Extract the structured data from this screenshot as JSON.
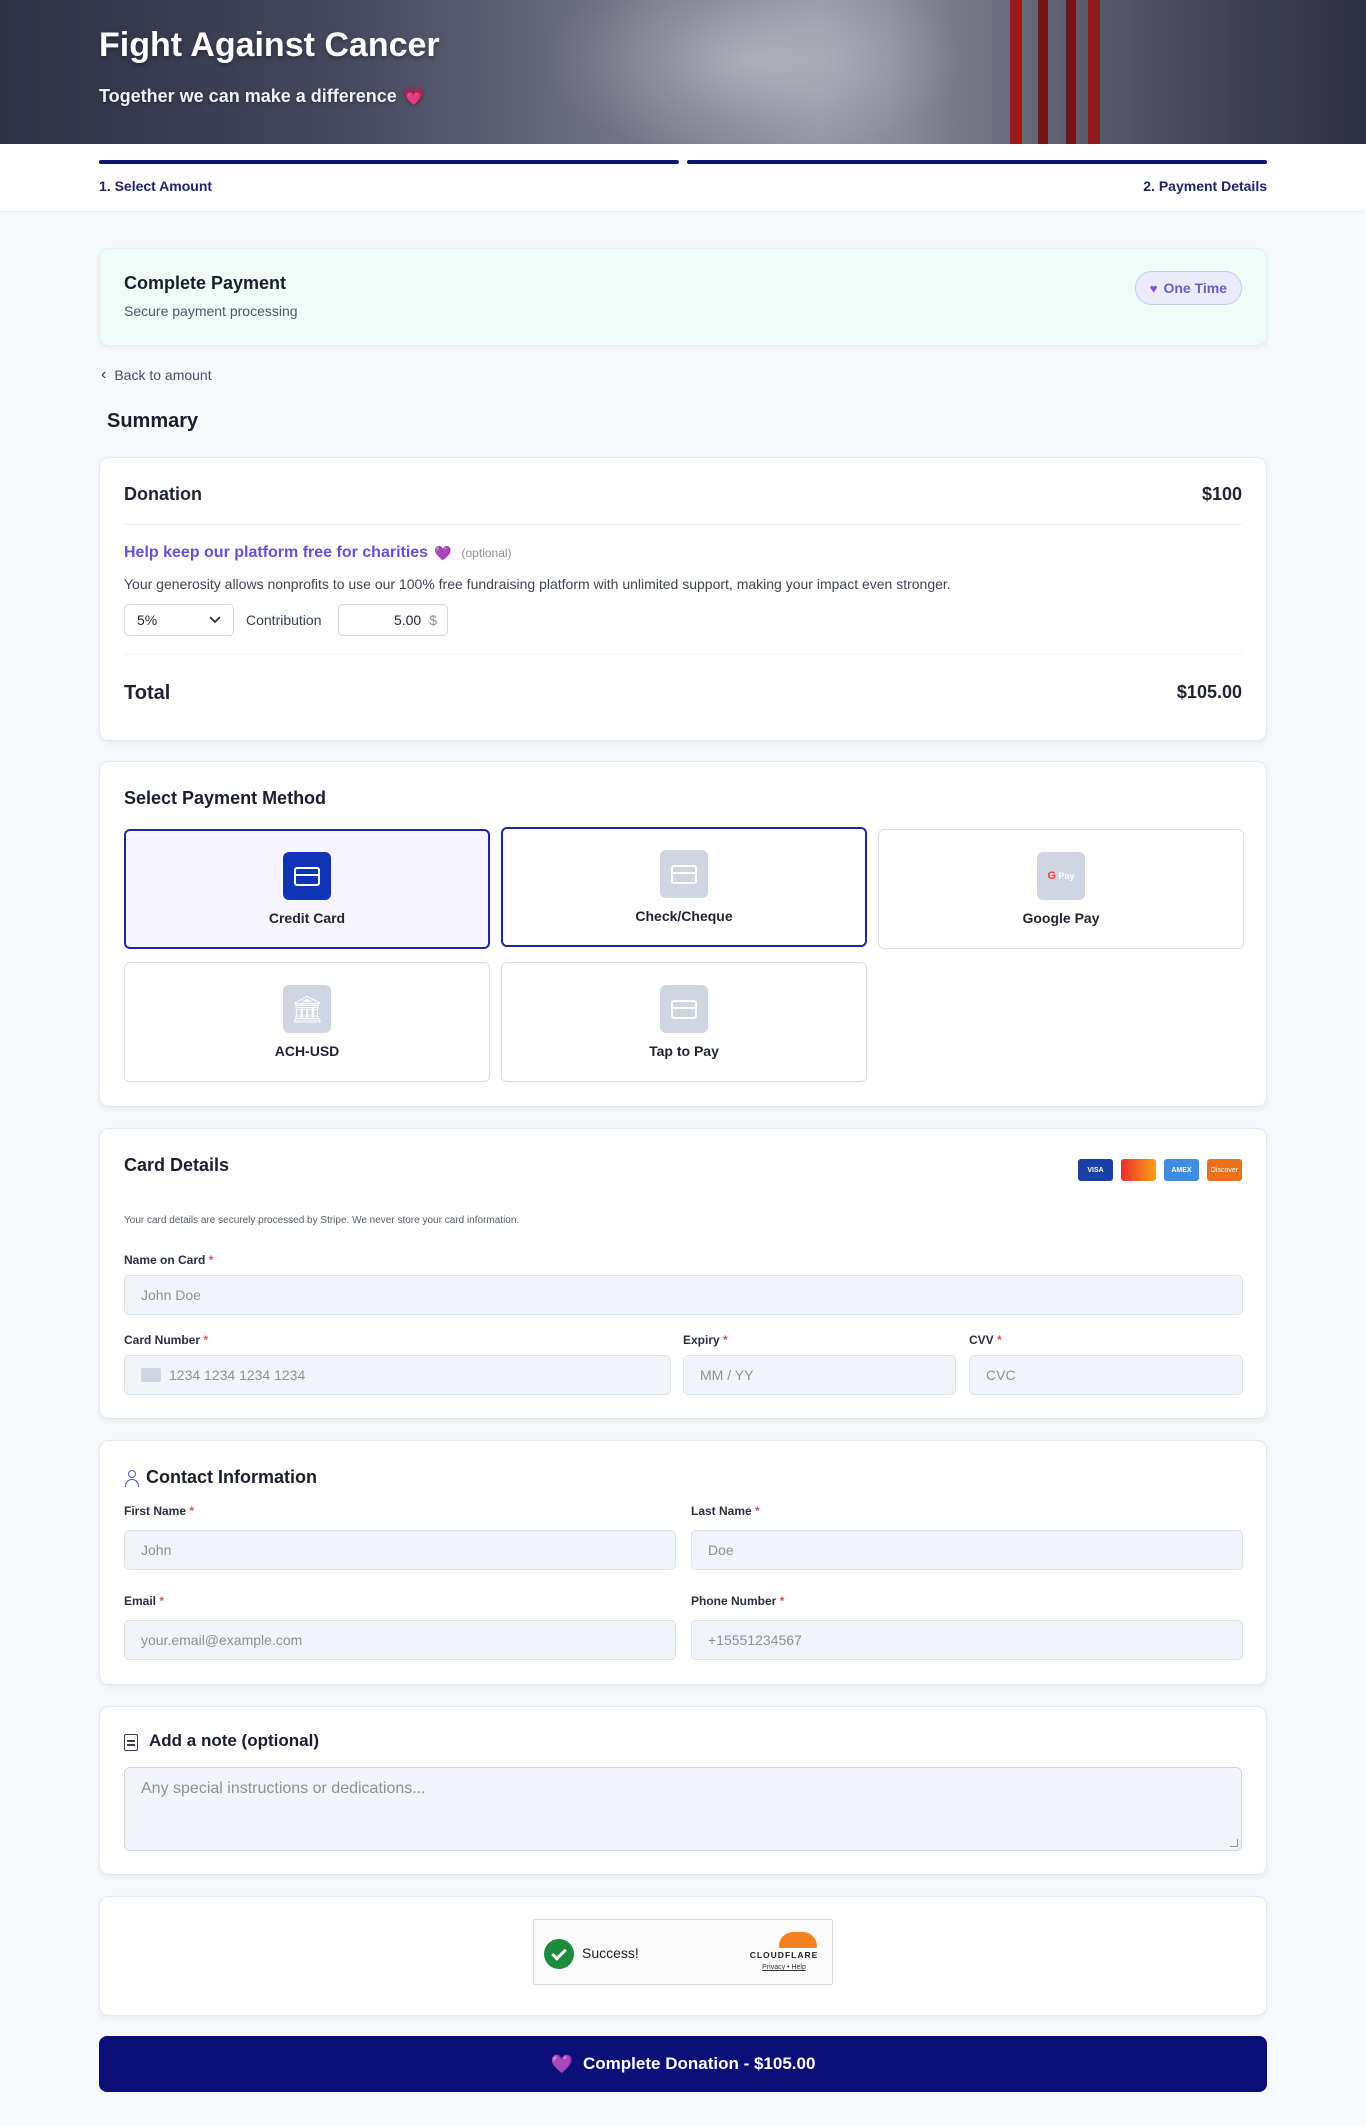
{
  "hero": {
    "title": "Fight Against Cancer",
    "subtitle": "Together we can make a difference",
    "subtitle_icon": "heart-icon"
  },
  "steps": [
    {
      "label": "1. Select Amount"
    },
    {
      "label": "2. Payment Details"
    }
  ],
  "payment_header": {
    "title": "Complete Payment",
    "subtitle": "Secure payment processing",
    "badge": "One Time"
  },
  "back_link": "Back to amount",
  "summary": {
    "heading": "Summary",
    "donation_label": "Donation",
    "donation_value": "$100",
    "help_title": "Help keep our platform free for charities",
    "help_optional": "(optional)",
    "help_text": "Your generosity allows nonprofits to use our 100% free fundraising platform with unlimited support, making your impact even stronger.",
    "percent_selected": "5%",
    "contribution_label": "Contribution",
    "contribution_value": "5.00",
    "contribution_currency": "$",
    "total_label": "Total",
    "total_value": "$105.00"
  },
  "payment_method": {
    "heading": "Select Payment Method",
    "options": [
      {
        "label": "Credit Card",
        "icon": "credit-card-icon",
        "selected": true
      },
      {
        "label": "Check/Cheque",
        "icon": "check-icon",
        "selected": false
      },
      {
        "label": "Google Pay",
        "icon": "google-pay-icon",
        "icon_text": "Pay",
        "selected": false
      },
      {
        "label": "ACH-USD",
        "icon": "bank-icon",
        "selected": false
      },
      {
        "label": "Tap to Pay",
        "icon": "tap-card-icon",
        "selected": false
      }
    ]
  },
  "card_details": {
    "heading": "Card Details",
    "brands": [
      "VISA",
      "",
      "AMEX",
      "Discover"
    ],
    "secure_note": "Your card details are securely processed by Stripe. We never store your card information.",
    "name_label": "Name on Card",
    "name_placeholder": "John Doe",
    "number_label": "Card Number",
    "number_placeholder": "1234 1234 1234 1234",
    "expiry_label": "Expiry",
    "expiry_placeholder": "MM / YY",
    "cvv_label": "CVV",
    "cvv_placeholder": "CVC",
    "required_mark": "*"
  },
  "contact": {
    "heading": "Contact Information",
    "first_label": "First Name",
    "first_placeholder": "John",
    "last_label": "Last Name",
    "last_placeholder": "Doe",
    "email_label": "Email",
    "email_placeholder": "your.email@example.com",
    "phone_label": "Phone Number",
    "phone_placeholder": "+15551234567"
  },
  "note": {
    "heading": "Add a note (optional)",
    "placeholder": "Any special instructions or dedications..."
  },
  "captcha": {
    "status": "Success!",
    "brand": "CLOUDFLARE",
    "links": "Privacy • Help"
  },
  "submit": {
    "label": "Complete Donation - $105.00"
  },
  "colors": {
    "primary": "#0b0f78",
    "accent_purple": "#6a4fd0",
    "selected_blue": "#1034b8"
  }
}
